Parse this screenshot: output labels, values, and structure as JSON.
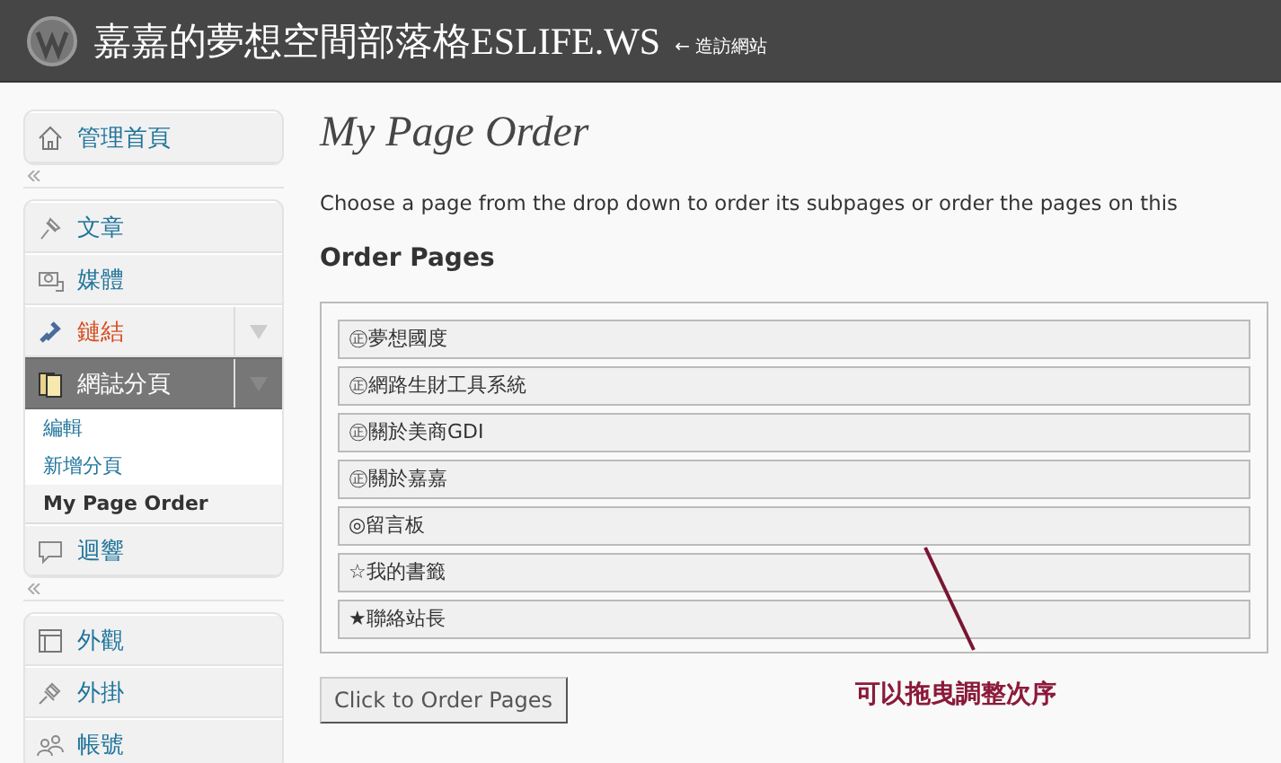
{
  "header": {
    "site_title": "嘉嘉的夢想空間部落格ESLIFE.WS",
    "visit_link": "← 造訪網站"
  },
  "sidebar": {
    "groups": [
      {
        "items": [
          {
            "label": "管理首頁",
            "selected": false,
            "highlighted": false,
            "toggle": false
          }
        ]
      },
      {
        "items": [
          {
            "label": "文章",
            "selected": false,
            "highlighted": false,
            "toggle": false
          },
          {
            "label": "媒體",
            "selected": false,
            "highlighted": false,
            "toggle": false
          },
          {
            "label": "鏈結",
            "selected": false,
            "highlighted": true,
            "toggle": true
          },
          {
            "label": "網誌分頁",
            "selected": true,
            "highlighted": false,
            "toggle": true,
            "children": [
              {
                "label": "編輯",
                "selected": false
              },
              {
                "label": "新增分頁",
                "selected": false
              },
              {
                "label": "My Page Order",
                "selected": true
              }
            ]
          },
          {
            "label": "迴響",
            "selected": false,
            "highlighted": false,
            "toggle": false
          }
        ]
      },
      {
        "items": [
          {
            "label": "外觀",
            "selected": false,
            "highlighted": false,
            "toggle": false
          },
          {
            "label": "外掛",
            "selected": false,
            "highlighted": false,
            "toggle": false
          },
          {
            "label": "帳號",
            "selected": false,
            "highlighted": false,
            "toggle": false
          }
        ]
      }
    ]
  },
  "main": {
    "title": "My Page Order",
    "description": "Choose a page from the drop down to order its subpages or order the pages on this",
    "section_title": "Order Pages",
    "pages": [
      "㊣夢想國度",
      "㊣網路生財工具系統",
      "㊣關於美商GDI",
      "㊣關於嘉嘉",
      "◎留言板",
      "☆我的書籤",
      "★聯絡站長"
    ],
    "button": "Click to Order Pages",
    "annotation": "可以拖曳調整次序"
  }
}
